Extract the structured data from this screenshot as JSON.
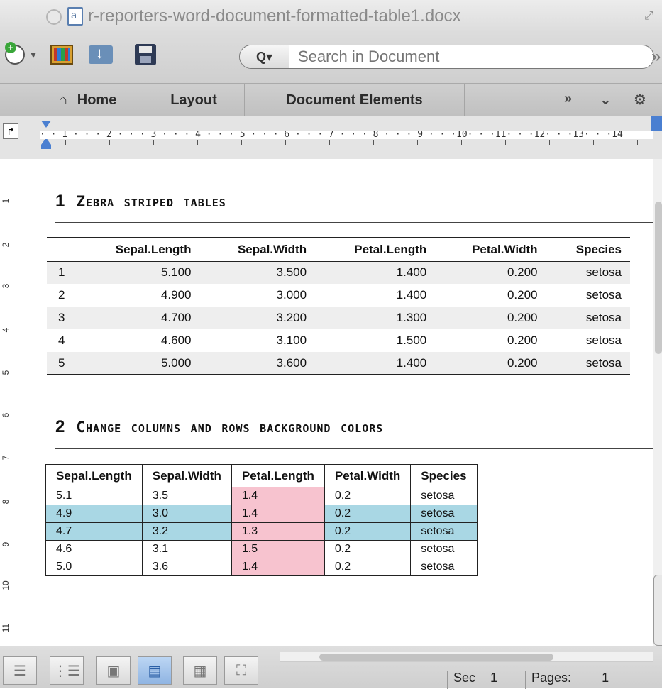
{
  "window": {
    "title": "r-reporters-word-document-formatted-table1.docx",
    "doc_icon_letter": "a"
  },
  "toolbar": {
    "search_placeholder": "Search in Document",
    "search_scope_label": "Q▾",
    "more_label": "»"
  },
  "ribbon": {
    "tabs": [
      {
        "label": "Home"
      },
      {
        "label": "Layout"
      },
      {
        "label": "Document Elements"
      }
    ],
    "overflow_label": "»",
    "collapse_label": "⌄",
    "gear_label": "⚙"
  },
  "ruler": {
    "marks": "· · 1 · · · 2 · · · 3 · · · 4 · · · 5 · · · 6 · · · 7 · · · 8 · · · 9 · · ·10· · ·11· · ·12· · ·13· · ·14",
    "vertical_labels": [
      "1",
      "2",
      "3",
      "4",
      "5",
      "6",
      "7",
      "8",
      "9",
      "10",
      "11"
    ]
  },
  "sections": [
    {
      "number": "1",
      "title": "Zebra striped tables"
    },
    {
      "number": "2",
      "title": "Change columns and rows background colors"
    }
  ],
  "table1": {
    "headers": [
      "",
      "Sepal.Length",
      "Sepal.Width",
      "Petal.Length",
      "Petal.Width",
      "Species"
    ],
    "rows": [
      [
        "1",
        "5.100",
        "3.500",
        "1.400",
        "0.200",
        "setosa"
      ],
      [
        "2",
        "4.900",
        "3.000",
        "1.400",
        "0.200",
        "setosa"
      ],
      [
        "3",
        "4.700",
        "3.200",
        "1.300",
        "0.200",
        "setosa"
      ],
      [
        "4",
        "4.600",
        "3.100",
        "1.500",
        "0.200",
        "setosa"
      ],
      [
        "5",
        "5.000",
        "3.600",
        "1.400",
        "0.200",
        "setosa"
      ]
    ],
    "stripe_color": "#eeeeee"
  },
  "table2": {
    "headers": [
      "Sepal.Length",
      "Sepal.Width",
      "Petal.Length",
      "Petal.Width",
      "Species"
    ],
    "rows": [
      [
        "5.1",
        "3.5",
        "1.4",
        "0.2",
        "setosa"
      ],
      [
        "4.9",
        "3.0",
        "1.4",
        "0.2",
        "setosa"
      ],
      [
        "4.7",
        "3.2",
        "1.3",
        "0.2",
        "setosa"
      ],
      [
        "4.6",
        "3.1",
        "1.5",
        "0.2",
        "setosa"
      ],
      [
        "5.0",
        "3.6",
        "1.4",
        "0.2",
        "setosa"
      ]
    ],
    "highlight_row_color": "#a9d7e4",
    "highlight_column_color": "#f7c3cf"
  },
  "status": {
    "section_label": "Sec",
    "section_value": "1",
    "pages_label": "Pages:",
    "pages_value": "1"
  },
  "view_buttons": [
    {
      "icon": "draft-view-icon",
      "glyph": "☰"
    },
    {
      "icon": "outline-view-icon",
      "glyph": "⋮☰"
    },
    {
      "icon": "publishing-layout-icon",
      "glyph": "▣"
    },
    {
      "icon": "print-layout-icon",
      "glyph": "▤"
    },
    {
      "icon": "notebook-layout-icon",
      "glyph": "▦"
    },
    {
      "icon": "full-screen-icon",
      "glyph": "⛶"
    }
  ]
}
